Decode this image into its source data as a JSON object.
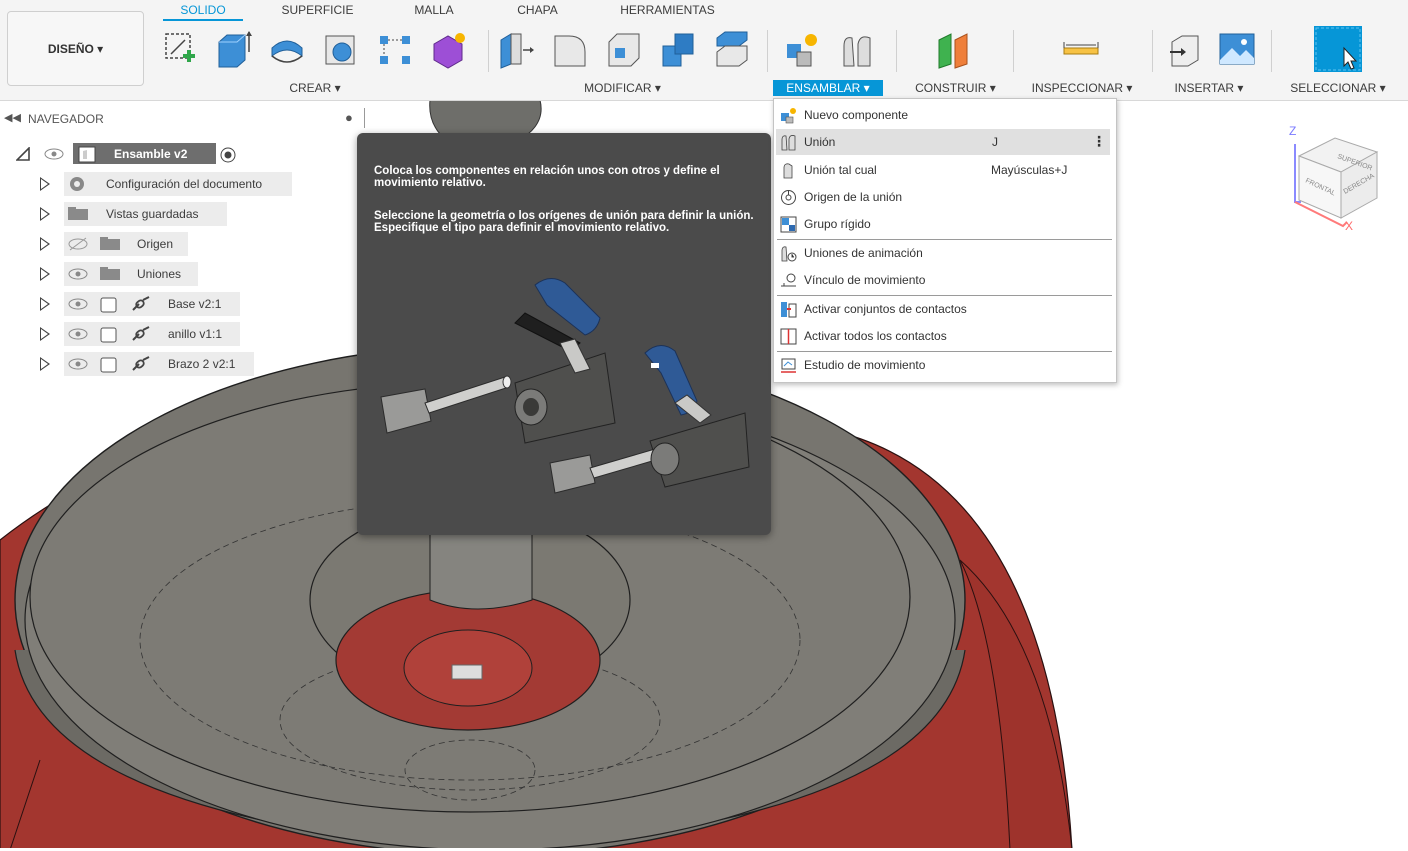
{
  "toolbar": {
    "tabs": [
      "SOLIDO",
      "SUPERFICIE",
      "MALLA",
      "CHAPA",
      "HERRAMIENTAS"
    ],
    "active_tab": "SOLIDO",
    "design_button": "DISEÑO ▾",
    "groups": {
      "crear": "CREAR ▾",
      "modificar": "MODIFICAR ▾",
      "ensamblar": "ENSAMBLAR ▾",
      "construir": "CONSTRUIR ▾",
      "inspeccionar": "INSPECCIONAR ▾",
      "insertar": "INSERTAR ▾",
      "seleccionar": "SELECCIONAR ▾"
    },
    "accent_color": "#0696d7"
  },
  "browser": {
    "title": "NAVEGADOR",
    "root": "Ensamble v2",
    "items": [
      {
        "label": "Configuración del documento",
        "icon": "gear-icon"
      },
      {
        "label": "Vistas guardadas",
        "icon": "folder-icon"
      },
      {
        "label": "Origen",
        "icon": "folder-icon",
        "hidden": true
      },
      {
        "label": "Uniones",
        "icon": "folder-icon"
      },
      {
        "label": "Base v2:1",
        "icon": "component-icon"
      },
      {
        "label": "anillo v1:1",
        "icon": "component-icon"
      },
      {
        "label": "Brazo 2 v2:1",
        "icon": "component-icon"
      }
    ]
  },
  "tooltip": {
    "line1": "Coloca los componentes en relación unos con otros y define el movimiento relativo.",
    "line2": "Seleccione la geometría o los orígenes de unión para definir la unión. Especifique el tipo para definir el movimiento relativo."
  },
  "menu": {
    "items": [
      {
        "label": "Nuevo componente",
        "shortcut": "",
        "icon": "new-component-icon"
      },
      {
        "label": "Unión",
        "shortcut": "J",
        "icon": "joint-icon",
        "highlighted": true
      },
      {
        "label": "Unión tal cual",
        "shortcut": "Mayúsculas+J",
        "icon": "as-built-joint-icon"
      },
      {
        "label": "Origen de la unión",
        "shortcut": "",
        "icon": "joint-origin-icon"
      },
      {
        "label": "Grupo rígido",
        "shortcut": "",
        "icon": "rigid-group-icon"
      },
      {
        "label": "Uniones de animación",
        "shortcut": "",
        "icon": "animate-joints-icon"
      },
      {
        "label": "Vínculo de movimiento",
        "shortcut": "",
        "icon": "motion-link-icon"
      },
      {
        "label": "Activar conjuntos de contactos",
        "shortcut": "",
        "icon": "contact-sets-icon"
      },
      {
        "label": "Activar todos los contactos",
        "shortcut": "",
        "icon": "all-contacts-icon"
      },
      {
        "label": "Estudio de movimiento",
        "shortcut": "",
        "icon": "motion-study-icon"
      }
    ]
  },
  "viewcube": {
    "z": "Z",
    "x": "X",
    "top": "SUPERIOR",
    "front": "FRONTAL",
    "right": "DERECHA"
  }
}
